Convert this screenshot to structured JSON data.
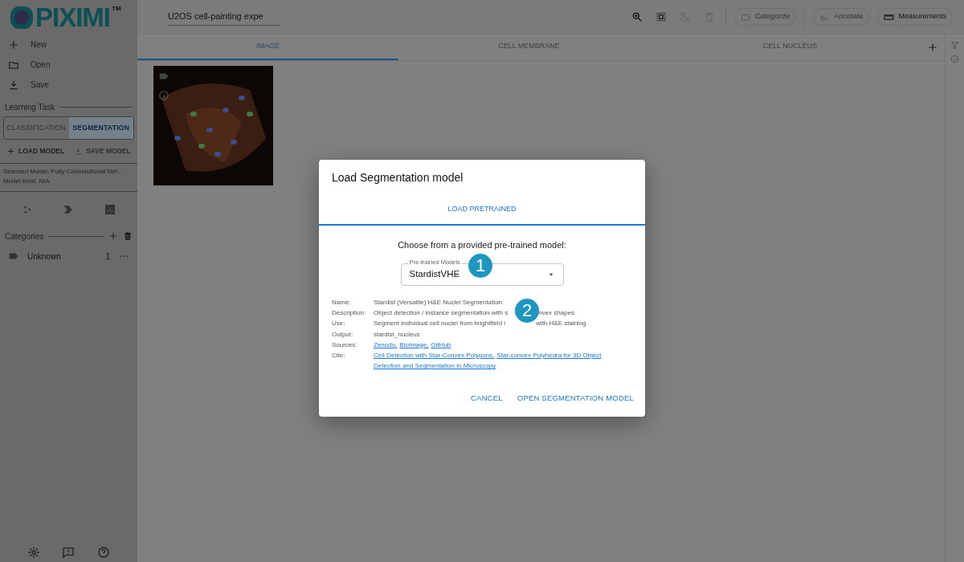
{
  "app": {
    "logo": "PIXIMI",
    "trademark": "TM",
    "project_name": "U2OS cell-painting expe"
  },
  "toolbar": {
    "icons": [
      {
        "kind": "zoom",
        "disabled": false
      },
      {
        "kind": "select",
        "disabled": false
      },
      {
        "kind": "deselect",
        "disabled": true
      },
      {
        "kind": "delete",
        "disabled": true
      }
    ],
    "chips": [
      {
        "kind": "categorize",
        "label": "Categorize",
        "disabled": true
      },
      {
        "kind": "annotate",
        "label": "Annotate",
        "disabled": true
      },
      {
        "kind": "measure",
        "label": "Measurements",
        "disabled": false
      }
    ]
  },
  "sidebar": {
    "file_items": [
      {
        "kind": "new",
        "label": "New"
      },
      {
        "kind": "open",
        "label": "Open"
      },
      {
        "kind": "save",
        "label": "Save"
      }
    ],
    "learning_task": {
      "title": "Learning Task",
      "tabs": [
        {
          "label": "CLASSIFICATION",
          "selected": false
        },
        {
          "label": "SEGMENTATION",
          "selected": true
        }
      ]
    },
    "model_buttons": [
      {
        "kind": "load",
        "label": "LOAD MODEL",
        "disabled": false
      },
      {
        "kind": "save",
        "label": "SAVE MODEL",
        "disabled": true
      }
    ],
    "model_info": [
      "Selected Model: Fully Convolutional Net…",
      "Model Kind: N/A"
    ],
    "categories": {
      "title": "Categories",
      "items": [
        {
          "label": "Unknown",
          "count": "1"
        }
      ]
    }
  },
  "tabs": [
    {
      "label": "IMAGE",
      "selected": true
    },
    {
      "label": "CELL MEMBRANE",
      "selected": false
    },
    {
      "label": "CELL NUCLEUS",
      "selected": false
    }
  ],
  "images": [
    {
      "kind": "picture"
    }
  ],
  "dialog": {
    "title": "Load Segmentation model",
    "tabs": [
      {
        "label": "LOAD PRETRAINED",
        "selected": true
      }
    ],
    "prompt": "Choose from a provided pre-trained model:",
    "select": {
      "label": "Pre-trained Models",
      "value": "StardistVHE"
    },
    "info": [
      {
        "label": "Name:",
        "kind": "text",
        "parts": [
          "Stardist (Versatile) H&E Nuclei Segmentation"
        ]
      },
      {
        "label": "Description:",
        "kind": "text",
        "parts": [
          "Object detection / instance segmentation with s",
          "nvex shapes"
        ]
      },
      {
        "label": "Use:",
        "kind": "text",
        "parts": [
          "Segment individual cell nuclei from brightfield i",
          "with H&E staining"
        ]
      },
      {
        "label": "Output:",
        "kind": "text",
        "parts": [
          "stardist_nucleus"
        ]
      },
      {
        "label": "Sources:",
        "kind": "links",
        "lines": [
          [
            "Zenodo,",
            "BioImage,",
            "GitHub"
          ]
        ]
      },
      {
        "label": "Cite:",
        "kind": "links",
        "lines": [
          [
            "Cell Detection with Star-Convex Polygons,",
            "Star-convex Polyhedra for 3D Object"
          ],
          [
            "Detection and Segmentation in Microscopy"
          ]
        ]
      }
    ],
    "buttons": [
      "CANCEL",
      "OPEN SEGMENTATION MODEL"
    ]
  },
  "callouts": [
    "1",
    "2"
  ]
}
